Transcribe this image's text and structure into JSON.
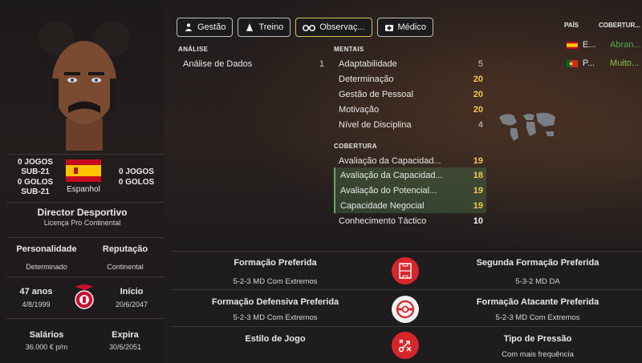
{
  "left": {
    "stats_left": [
      "0 JOGOS",
      "SUB-21",
      "0 GOLOS",
      "SUB-21"
    ],
    "stats_right": [
      "0 JOGOS",
      "0 GOLOS"
    ],
    "nationality": "Espanhol",
    "role": "Director Desportivo",
    "licence": "Licença Pro Continental",
    "personality_label": "Personalidade",
    "personality_value": "Determinado",
    "reputation_label": "Reputação",
    "reputation_value": "Continental",
    "age": "47 anos",
    "dob": "4/8/1999",
    "start_label": "Início",
    "start_value": "20/6/2047",
    "salary_label": "Salários",
    "salary_value": "36.000 € p/m",
    "expiry_label": "Expira",
    "expiry_value": "30/6/2051"
  },
  "tabs": [
    {
      "label": "Gestão",
      "icon": "people-icon"
    },
    {
      "label": "Treino",
      "icon": "cone-icon"
    },
    {
      "label": "Observaç...",
      "icon": "binoculars-icon",
      "active": true
    },
    {
      "label": "Médico",
      "icon": "medical-kit-icon"
    }
  ],
  "analysis": {
    "title": "ANÁLISE",
    "rows": [
      {
        "label": "Análise de Dados",
        "value": "1"
      }
    ]
  },
  "mental": {
    "title": "MENTAIS",
    "rows": [
      {
        "label": "Adaptabilidade",
        "value": "5"
      },
      {
        "label": "Determinação",
        "value": "20"
      },
      {
        "label": "Gestão de Pessoal",
        "value": "20"
      },
      {
        "label": "Motivação",
        "value": "20"
      },
      {
        "label": "Nível de Disciplina",
        "value": "4"
      }
    ]
  },
  "coverage_attrs": {
    "title": "COBERTURA",
    "rows": [
      {
        "label": "Avaliação da Capacidad...",
        "value": "19"
      },
      {
        "label": "Avaliação da Capacidad...",
        "value": "18"
      },
      {
        "label": "Avaliação do Potencial...",
        "value": "19"
      },
      {
        "label": "Capacidade Negocial",
        "value": "19"
      },
      {
        "label": "Conhecimento Táctico",
        "value": "10"
      }
    ]
  },
  "countries": {
    "country_header": "PAÍS",
    "coverage_header": "COBERTUR...",
    "rows": [
      {
        "country": "E...",
        "coverage": "Abran...",
        "color": "#4caf50"
      },
      {
        "country": "P...",
        "coverage": "Muito...",
        "color": "#8bc34a"
      }
    ]
  },
  "tactics": {
    "preferred_formation_label": "Formação Preferida",
    "preferred_formation_value": "5-2-3 MD Com Extremos",
    "second_formation_label": "Segunda Formação Preferida",
    "second_formation_value": "5-3-2 MD DA",
    "defensive_formation_label": "Formação Defensiva Preferida",
    "defensive_formation_value": "5-2-3 MD Com Extremos",
    "attacking_formation_label": "Formação Atacante Preferida",
    "attacking_formation_value": "5-2-3 MD Com Extremos",
    "play_style_label": "Estilo de Jogo",
    "pressing_label": "Tipo de Pressão",
    "pressing_value": "Com mais frequência"
  },
  "colors": {
    "accent_red": "#d7262b",
    "gold": "#f2c94c",
    "highlight_green": "#6aa56a"
  }
}
